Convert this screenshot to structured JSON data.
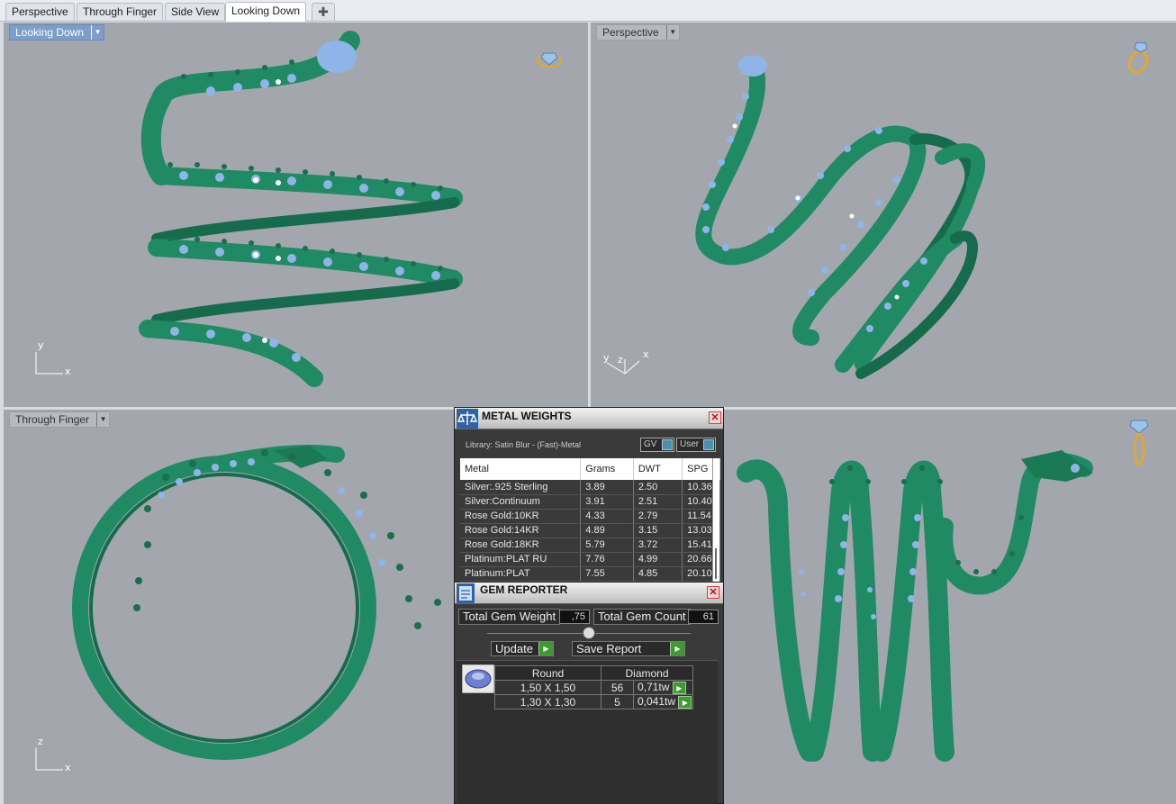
{
  "tabs": [
    {
      "label": "Perspective",
      "active": false
    },
    {
      "label": "Through Finger",
      "active": false
    },
    {
      "label": "Side View",
      "active": false
    },
    {
      "label": "Looking Down",
      "active": true
    }
  ],
  "tab_add_glyph": "✚",
  "viewports": {
    "top_left": {
      "title": "Looking Down",
      "axis_a": "y",
      "axis_b": "x"
    },
    "top_right": {
      "title": "Perspective",
      "axis_a": "y",
      "axis_b": "z",
      "axis_c": "x"
    },
    "bottom_left": {
      "title": "Through Finger",
      "axis_a": "z",
      "axis_b": "x"
    }
  },
  "colors": {
    "viewport_bg": "#a3a7ad",
    "metal": "#1f8a63",
    "gem": "#8fb4e8",
    "bead": "#1c6e4c",
    "active_view": "#7c9ec9"
  },
  "metal_weights": {
    "title": "METAL WEIGHTS",
    "library": "Library: Satin Blur - (Fast)-Metal",
    "toggle_gv": "GV",
    "toggle_user": "User",
    "columns": [
      "Metal",
      "Grams",
      "DWT",
      "SPG"
    ],
    "rows": [
      [
        "Silver:.925 Sterling",
        "3.89",
        "2.50",
        "10.36"
      ],
      [
        "Silver:Continuum",
        "3.91",
        "2.51",
        "10.40"
      ],
      [
        "Rose Gold:10KR",
        "4.33",
        "2.79",
        "11.54"
      ],
      [
        "Rose Gold:14KR",
        "4.89",
        "3.15",
        "13.03"
      ],
      [
        "Rose Gold:18KR",
        "5.79",
        "3.72",
        "15.41"
      ],
      [
        "Platinum:PLAT RU",
        "7.76",
        "4.99",
        "20.66"
      ],
      [
        "Platinum:PLAT",
        "7.55",
        "4.85",
        "20.10"
      ]
    ]
  },
  "gem_reporter": {
    "title": "GEM REPORTER",
    "total_weight_label": "Total Gem Weight",
    "total_weight_value": ",75",
    "total_count_label": "Total Gem Count",
    "total_count_value": "61",
    "update_label": "Update",
    "save_report_label": "Save Report",
    "grid_header": [
      "Round",
      "Diamond"
    ],
    "grid_rows": [
      {
        "size": "1,50 X 1,50",
        "count": "56",
        "weight": "0,71tw"
      },
      {
        "size": "1,30 X 1,30",
        "count": "5",
        "weight": "0,041tw"
      }
    ]
  }
}
